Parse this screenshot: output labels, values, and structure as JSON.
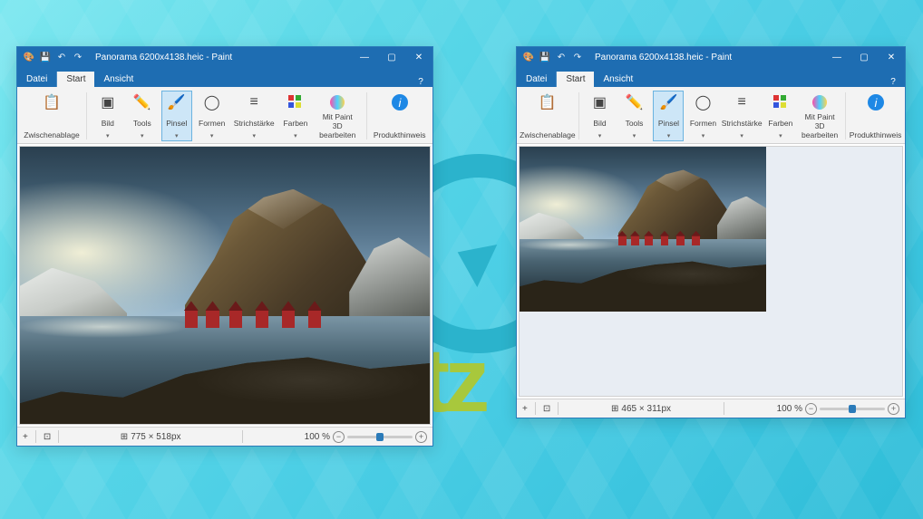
{
  "background": {
    "watermark_text": "tz"
  },
  "ribbon_labels": {
    "zwischenablage": "Zwischenablage",
    "bild": "Bild",
    "tools": "Tools",
    "pinsel": "Pinsel",
    "formen": "Formen",
    "strichstaerke": "Strichstärke",
    "farben": "Farben",
    "paint3d_l1": "Mit Paint 3D",
    "paint3d_l2": "bearbeiten",
    "produkthinweis": "Produkthinweis"
  },
  "window1": {
    "title": "Panorama 6200x4138.heic - Paint",
    "tabs": {
      "file": "Datei",
      "start": "Start",
      "view": "Ansicht"
    },
    "status": {
      "coord_icon": "+",
      "dimensions": "775 × 518px",
      "zoom": "100 %"
    }
  },
  "window2": {
    "title": "Panorama 6200x4138.heic - Paint",
    "tabs": {
      "file": "Datei",
      "start": "Start",
      "view": "Ansicht"
    },
    "status": {
      "coord_icon": "+",
      "dimensions": "465 × 311px",
      "zoom": "100 %"
    }
  }
}
